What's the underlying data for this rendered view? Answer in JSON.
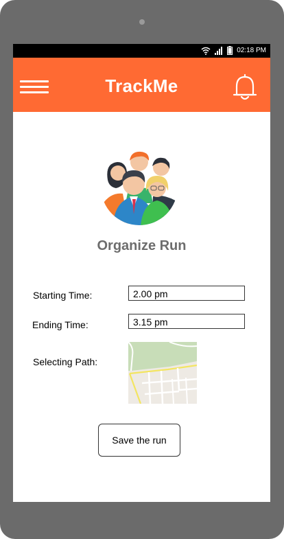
{
  "status_bar": {
    "time": "02:18 PM"
  },
  "app_bar": {
    "title": "TrackMe"
  },
  "main": {
    "heading": "Organize Run",
    "form": {
      "starting_time_label": "Starting Time:",
      "starting_time_value": "2.00 pm",
      "ending_time_label": "Ending Time:",
      "ending_time_value": "3.15 pm",
      "selecting_path_label": "Selecting Path:"
    },
    "save_button_label": "Save the run"
  },
  "colors": {
    "brand": "#ff6a33",
    "heading_text": "#6d6d6d",
    "device_frame": "#6b6b6b"
  },
  "icons": [
    "wifi-icon",
    "signal-icon",
    "battery-icon",
    "hamburger-menu-icon",
    "bell-icon",
    "people-group-icon",
    "map-icon"
  ]
}
